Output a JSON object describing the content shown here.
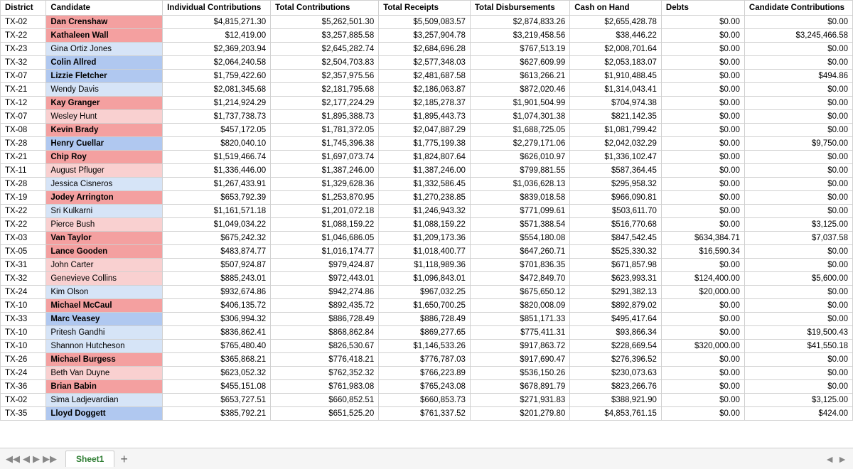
{
  "headers": {
    "district": "District",
    "candidate": "Candidate",
    "individual": "Individual Contributions",
    "total_contrib": "Total Contributions",
    "total_receipts": "Total Receipts",
    "total_disb": "Total Disbursements",
    "cash": "Cash on Hand",
    "debts": "Debts",
    "cand_contrib": "Candidate Contributions"
  },
  "rows": [
    {
      "district": "TX-02",
      "candidate": "Dan Crenshaw",
      "style": "red-bg",
      "individual": "$4,815,271.30",
      "total_contrib": "$5,262,501.30",
      "total_receipts": "$5,509,083.57",
      "total_disb": "$2,874,833.26",
      "cash": "$2,655,428.78",
      "debts": "$0.00",
      "cand_contrib": "$0.00"
    },
    {
      "district": "TX-22",
      "candidate": "Kathaleen Wall",
      "style": "red-bg",
      "individual": "$12,419.00",
      "total_contrib": "$3,257,885.58",
      "total_receipts": "$3,257,904.78",
      "total_disb": "$3,219,458.56",
      "cash": "$38,446.22",
      "debts": "$0.00",
      "cand_contrib": "$3,245,466.58"
    },
    {
      "district": "TX-23",
      "candidate": "Gina Ortiz Jones",
      "style": "light-blue",
      "individual": "$2,369,203.94",
      "total_contrib": "$2,645,282.74",
      "total_receipts": "$2,684,696.28",
      "total_disb": "$767,513.19",
      "cash": "$2,008,701.64",
      "debts": "$0.00",
      "cand_contrib": "$0.00"
    },
    {
      "district": "TX-32",
      "candidate": "Colin Allred",
      "style": "blue-bg",
      "individual": "$2,064,240.58",
      "total_contrib": "$2,504,703.83",
      "total_receipts": "$2,577,348.03",
      "total_disb": "$627,609.99",
      "cash": "$2,053,183.07",
      "debts": "$0.00",
      "cand_contrib": "$0.00"
    },
    {
      "district": "TX-07",
      "candidate": "Lizzie Fletcher",
      "style": "blue-bg",
      "individual": "$1,759,422.60",
      "total_contrib": "$2,357,975.56",
      "total_receipts": "$2,481,687.58",
      "total_disb": "$613,266.21",
      "cash": "$1,910,488.45",
      "debts": "$0.00",
      "cand_contrib": "$494.86"
    },
    {
      "district": "TX-21",
      "candidate": "Wendy Davis",
      "style": "light-blue",
      "individual": "$2,081,345.68",
      "total_contrib": "$2,181,795.68",
      "total_receipts": "$2,186,063.87",
      "total_disb": "$872,020.46",
      "cash": "$1,314,043.41",
      "debts": "$0.00",
      "cand_contrib": "$0.00"
    },
    {
      "district": "TX-12",
      "candidate": "Kay Granger",
      "style": "red-bg",
      "individual": "$1,214,924.29",
      "total_contrib": "$2,177,224.29",
      "total_receipts": "$2,185,278.37",
      "total_disb": "$1,901,504.99",
      "cash": "$704,974.38",
      "debts": "$0.00",
      "cand_contrib": "$0.00"
    },
    {
      "district": "TX-07",
      "candidate": "Wesley Hunt",
      "style": "light-red",
      "individual": "$1,737,738.73",
      "total_contrib": "$1,895,388.73",
      "total_receipts": "$1,895,443.73",
      "total_disb": "$1,074,301.38",
      "cash": "$821,142.35",
      "debts": "$0.00",
      "cand_contrib": "$0.00"
    },
    {
      "district": "TX-08",
      "candidate": "Kevin Brady",
      "style": "red-bg",
      "individual": "$457,172.05",
      "total_contrib": "$1,781,372.05",
      "total_receipts": "$2,047,887.29",
      "total_disb": "$1,688,725.05",
      "cash": "$1,081,799.42",
      "debts": "$0.00",
      "cand_contrib": "$0.00"
    },
    {
      "district": "TX-28",
      "candidate": "Henry Cuellar",
      "style": "blue-bg",
      "individual": "$820,040.10",
      "total_contrib": "$1,745,396.38",
      "total_receipts": "$1,775,199.38",
      "total_disb": "$2,279,171.06",
      "cash": "$2,042,032.29",
      "debts": "$0.00",
      "cand_contrib": "$9,750.00"
    },
    {
      "district": "TX-21",
      "candidate": "Chip Roy",
      "style": "red-bg",
      "individual": "$1,519,466.74",
      "total_contrib": "$1,697,073.74",
      "total_receipts": "$1,824,807.64",
      "total_disb": "$626,010.97",
      "cash": "$1,336,102.47",
      "debts": "$0.00",
      "cand_contrib": "$0.00"
    },
    {
      "district": "TX-11",
      "candidate": "August Pfluger",
      "style": "light-red",
      "individual": "$1,336,446.00",
      "total_contrib": "$1,387,246.00",
      "total_receipts": "$1,387,246.00",
      "total_disb": "$799,881.55",
      "cash": "$587,364.45",
      "debts": "$0.00",
      "cand_contrib": "$0.00"
    },
    {
      "district": "TX-28",
      "candidate": "Jessica Cisneros",
      "style": "light-blue",
      "individual": "$1,267,433.91",
      "total_contrib": "$1,329,628.36",
      "total_receipts": "$1,332,586.45",
      "total_disb": "$1,036,628.13",
      "cash": "$295,958.32",
      "debts": "$0.00",
      "cand_contrib": "$0.00"
    },
    {
      "district": "TX-19",
      "candidate": "Jodey Arrington",
      "style": "red-bg",
      "individual": "$653,792.39",
      "total_contrib": "$1,253,870.95",
      "total_receipts": "$1,270,238.85",
      "total_disb": "$839,018.58",
      "cash": "$966,090.81",
      "debts": "$0.00",
      "cand_contrib": "$0.00"
    },
    {
      "district": "TX-22",
      "candidate": "Sri Kulkarni",
      "style": "light-blue",
      "individual": "$1,161,571.18",
      "total_contrib": "$1,201,072.18",
      "total_receipts": "$1,246,943.32",
      "total_disb": "$771,099.61",
      "cash": "$503,611.70",
      "debts": "$0.00",
      "cand_contrib": "$0.00"
    },
    {
      "district": "TX-22",
      "candidate": "Pierce Bush",
      "style": "light-red",
      "individual": "$1,049,034.22",
      "total_contrib": "$1,088,159.22",
      "total_receipts": "$1,088,159.22",
      "total_disb": "$571,388.54",
      "cash": "$516,770.68",
      "debts": "$0.00",
      "cand_contrib": "$3,125.00"
    },
    {
      "district": "TX-03",
      "candidate": "Van Taylor",
      "style": "red-bg",
      "individual": "$675,242.32",
      "total_contrib": "$1,046,686.05",
      "total_receipts": "$1,209,173.36",
      "total_disb": "$554,180.08",
      "cash": "$847,542.45",
      "debts": "$634,384.71",
      "cand_contrib": "$7,037.58"
    },
    {
      "district": "TX-05",
      "candidate": "Lance Gooden",
      "style": "red-bg",
      "individual": "$483,874.77",
      "total_contrib": "$1,016,174.77",
      "total_receipts": "$1,018,400.77",
      "total_disb": "$647,260.71",
      "cash": "$525,330.32",
      "debts": "$16,590.34",
      "cand_contrib": "$0.00"
    },
    {
      "district": "TX-31",
      "candidate": "John Carter",
      "style": "light-red",
      "individual": "$507,924.87",
      "total_contrib": "$979,424.87",
      "total_receipts": "$1,118,989.36",
      "total_disb": "$701,836.35",
      "cash": "$671,857.98",
      "debts": "$0.00",
      "cand_contrib": "$0.00"
    },
    {
      "district": "TX-32",
      "candidate": "Genevieve Collins",
      "style": "light-red",
      "individual": "$885,243.01",
      "total_contrib": "$972,443.01",
      "total_receipts": "$1,096,843.01",
      "total_disb": "$472,849.70",
      "cash": "$623,993.31",
      "debts": "$124,400.00",
      "cand_contrib": "$5,600.00"
    },
    {
      "district": "TX-24",
      "candidate": "Kim Olson",
      "style": "light-blue",
      "individual": "$932,674.86",
      "total_contrib": "$942,274.86",
      "total_receipts": "$967,032.25",
      "total_disb": "$675,650.12",
      "cash": "$291,382.13",
      "debts": "$20,000.00",
      "cand_contrib": "$0.00"
    },
    {
      "district": "TX-10",
      "candidate": "Michael McCaul",
      "style": "red-bg",
      "individual": "$406,135.72",
      "total_contrib": "$892,435.72",
      "total_receipts": "$1,650,700.25",
      "total_disb": "$820,008.09",
      "cash": "$892,879.02",
      "debts": "$0.00",
      "cand_contrib": "$0.00"
    },
    {
      "district": "TX-33",
      "candidate": "Marc Veasey",
      "style": "blue-bg",
      "individual": "$306,994.32",
      "total_contrib": "$886,728.49",
      "total_receipts": "$886,728.49",
      "total_disb": "$851,171.33",
      "cash": "$495,417.64",
      "debts": "$0.00",
      "cand_contrib": "$0.00"
    },
    {
      "district": "TX-10",
      "candidate": "Pritesh Gandhi",
      "style": "light-blue",
      "individual": "$836,862.41",
      "total_contrib": "$868,862.84",
      "total_receipts": "$869,277.65",
      "total_disb": "$775,411.31",
      "cash": "$93,866.34",
      "debts": "$0.00",
      "cand_contrib": "$19,500.43"
    },
    {
      "district": "TX-10",
      "candidate": "Shannon Hutcheson",
      "style": "light-blue",
      "individual": "$765,480.40",
      "total_contrib": "$826,530.67",
      "total_receipts": "$1,146,533.26",
      "total_disb": "$917,863.72",
      "cash": "$228,669.54",
      "debts": "$320,000.00",
      "cand_contrib": "$41,550.18"
    },
    {
      "district": "TX-26",
      "candidate": "Michael Burgess",
      "style": "red-bg",
      "individual": "$365,868.21",
      "total_contrib": "$776,418.21",
      "total_receipts": "$776,787.03",
      "total_disb": "$917,690.47",
      "cash": "$276,396.52",
      "debts": "$0.00",
      "cand_contrib": "$0.00"
    },
    {
      "district": "TX-24",
      "candidate": "Beth Van Duyne",
      "style": "light-red",
      "individual": "$623,052.32",
      "total_contrib": "$762,352.32",
      "total_receipts": "$766,223.89",
      "total_disb": "$536,150.26",
      "cash": "$230,073.63",
      "debts": "$0.00",
      "cand_contrib": "$0.00"
    },
    {
      "district": "TX-36",
      "candidate": "Brian Babin",
      "style": "red-bg",
      "individual": "$455,151.08",
      "total_contrib": "$761,983.08",
      "total_receipts": "$765,243.08",
      "total_disb": "$678,891.79",
      "cash": "$823,266.76",
      "debts": "$0.00",
      "cand_contrib": "$0.00"
    },
    {
      "district": "TX-02",
      "candidate": "Sima Ladjevardian",
      "style": "light-blue",
      "individual": "$653,727.51",
      "total_contrib": "$660,852.51",
      "total_receipts": "$660,853.73",
      "total_disb": "$271,931.83",
      "cash": "$388,921.90",
      "debts": "$0.00",
      "cand_contrib": "$3,125.00"
    },
    {
      "district": "TX-35",
      "candidate": "Lloyd Doggett",
      "style": "blue-bg",
      "individual": "$385,792.21",
      "total_contrib": "$651,525.20",
      "total_receipts": "$761,337.52",
      "total_disb": "$201,279.80",
      "cash": "$4,853,761.15",
      "debts": "$0.00",
      "cand_contrib": "$424.00"
    }
  ],
  "sheet": {
    "tab_name": "Sheet1",
    "add_label": "+"
  }
}
